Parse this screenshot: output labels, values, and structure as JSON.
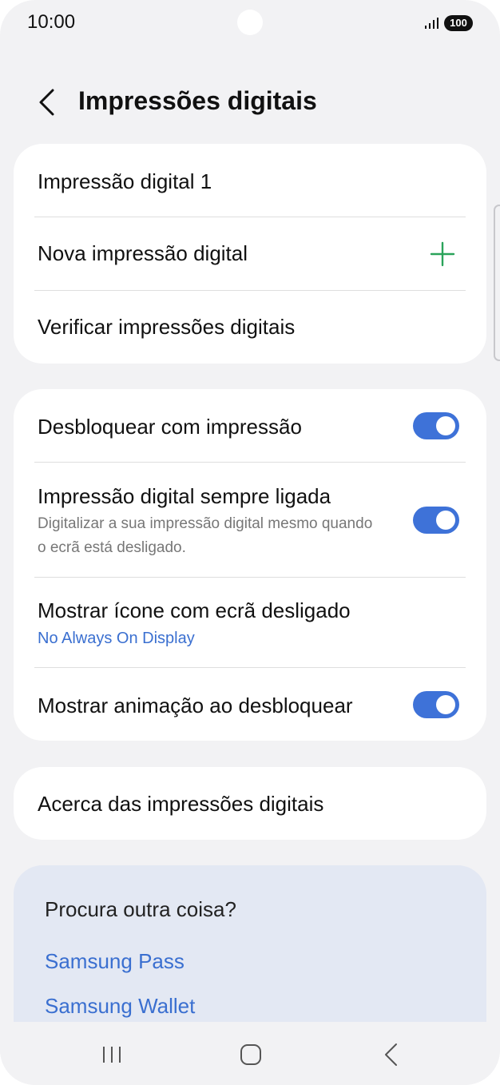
{
  "status_bar": {
    "time": "10:00",
    "battery": "100"
  },
  "header": {
    "title": "Impressões digitais"
  },
  "fingerprints_card": {
    "items": [
      {
        "label": "Impressão digital 1"
      },
      {
        "label": "Nova impressão digital"
      },
      {
        "label": "Verificar impressões digitais"
      }
    ]
  },
  "options_card": {
    "unlock": {
      "label": "Desbloquear com impressão",
      "enabled": true
    },
    "always_on": {
      "label": "Impressão digital sempre ligada",
      "description": "Digitalizar a sua impressão digital mesmo quando o ecrã está desligado.",
      "enabled": true
    },
    "show_icon": {
      "label": "Mostrar ícone com ecrã desligado",
      "value": "No Always On Display"
    },
    "animation": {
      "label": "Mostrar animação ao desbloquear",
      "enabled": true
    }
  },
  "about_card": {
    "label": "Acerca das impressões digitais"
  },
  "suggestions": {
    "title": "Procura outra coisa?",
    "links": [
      "Samsung Pass",
      "Samsung Wallet"
    ]
  },
  "icons": {
    "back": "chevron-left-icon",
    "add": "plus-icon",
    "nav_recent": "recent-apps-icon",
    "nav_home": "home-icon",
    "nav_back": "back-icon"
  },
  "colors": {
    "accent": "#3e72d8",
    "link": "#3a6fd0",
    "add_icon": "#2aa35a",
    "background": "#f2f2f4",
    "suggestion_background": "#e3e8f3"
  }
}
